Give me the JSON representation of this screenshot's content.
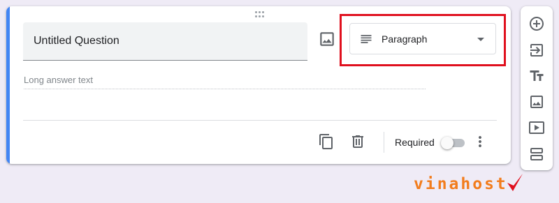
{
  "question": {
    "title": "Untitled Question",
    "type_label": "Paragraph",
    "answer_placeholder": "Long answer text"
  },
  "footer": {
    "required_label": "Required",
    "required": false
  },
  "toolbar": {
    "icons": [
      "add-question-icon",
      "import-questions-icon",
      "add-title-icon",
      "add-image-icon",
      "add-video-icon",
      "add-section-icon"
    ]
  },
  "brand": {
    "logo_text": "vinahost",
    "logo_color": "#f27c1c"
  },
  "colors": {
    "accent": "#4285f4",
    "highlight": "#e0101e",
    "icon": "#5f6368"
  }
}
